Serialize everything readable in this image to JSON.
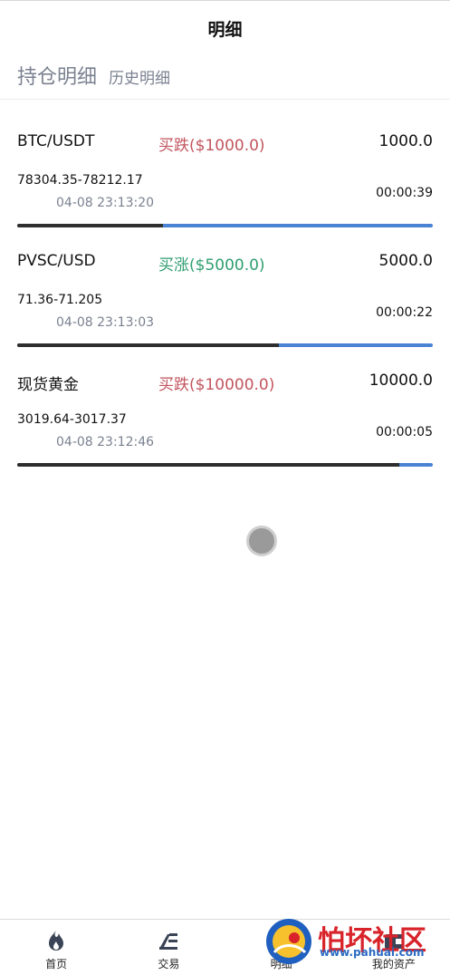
{
  "header": {
    "title": "明细"
  },
  "tabs": {
    "active": "持仓明细",
    "other": "历史明细"
  },
  "positions": [
    {
      "name": "BTC/USDT",
      "action": "买跌($1000.0)",
      "direction": "down",
      "amount": "1000.0",
      "range": "78304.35-78212.17",
      "time": "04-08 23:13:20",
      "countdown": "00:00:39",
      "progress": 0.35
    },
    {
      "name": "PVSC/USD",
      "action": "买涨($5000.0)",
      "direction": "up",
      "amount": "5000.0",
      "range": "71.36-71.205",
      "time": "04-08 23:13:03",
      "countdown": "00:00:22",
      "progress": 0.63
    },
    {
      "name": "现货黄金",
      "action": "买跌($10000.0)",
      "direction": "down",
      "amount": "10000.0",
      "range": "3019.64-3017.37",
      "time": "04-08 23:12:46",
      "countdown": "00:00:05",
      "progress": 0.92
    }
  ],
  "nav": [
    {
      "label": "首页",
      "icon": "flame-icon"
    },
    {
      "label": "交易",
      "icon": "trade-icon"
    },
    {
      "label": "明细",
      "icon": "detail-icon"
    },
    {
      "label": "我的资产",
      "icon": "assets-icon"
    }
  ],
  "watermark": {
    "text": "怕坏社区",
    "url": "www.pahuai.com"
  },
  "colors": {
    "down": "#c2555e",
    "up": "#2f9e6f",
    "bar_remaining": "#4a83d4",
    "bar_elapsed": "#2e2e2e"
  }
}
